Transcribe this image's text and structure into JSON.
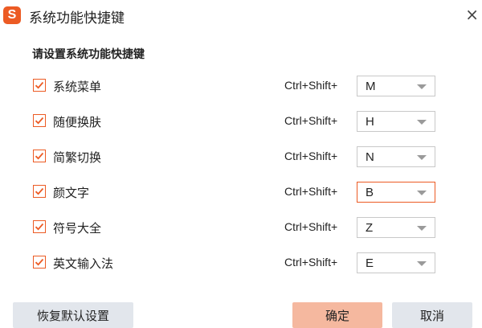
{
  "window": {
    "logo_text": "S",
    "title": "系统功能快捷键",
    "close_glyph": "×"
  },
  "heading": "请设置系统功能快捷键",
  "shortcuts": [
    {
      "label": "系统菜单",
      "checked": true,
      "prefix": "Ctrl+Shift+",
      "key": "M"
    },
    {
      "label": "随便换肤",
      "checked": true,
      "prefix": "Ctrl+Shift+",
      "key": "H"
    },
    {
      "label": "简繁切换",
      "checked": true,
      "prefix": "Ctrl+Shift+",
      "key": "N"
    },
    {
      "label": "颜文字",
      "checked": true,
      "prefix": "Ctrl+Shift+",
      "key": "B",
      "active": true
    },
    {
      "label": "符号大全",
      "checked": true,
      "prefix": "Ctrl+Shift+",
      "key": "Z"
    },
    {
      "label": "英文输入法",
      "checked": true,
      "prefix": "Ctrl+Shift+",
      "key": "E"
    }
  ],
  "buttons": {
    "reset": "恢复默认设置",
    "ok": "确定",
    "cancel": "取消"
  },
  "colors": {
    "accent": "#ec5b24",
    "primary_button": "#f5b89f",
    "secondary_button": "#e2e6ec"
  }
}
